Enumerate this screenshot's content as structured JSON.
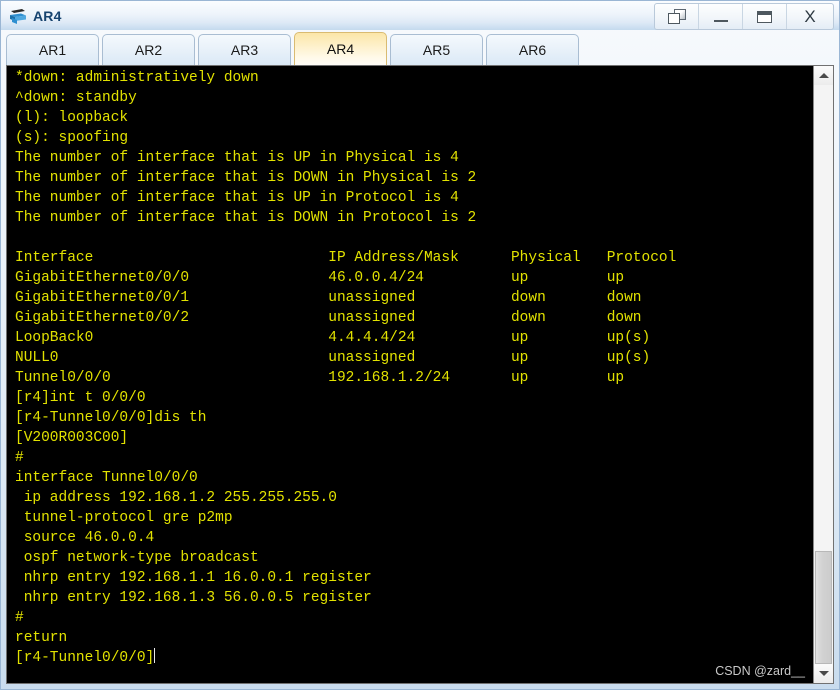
{
  "window": {
    "title": "AR4",
    "icon": "router-icon",
    "controls": [
      {
        "name": "restore-button",
        "icon": "restore-icon",
        "label": ""
      },
      {
        "name": "minimize-button",
        "icon": "minimize-icon",
        "label": ""
      },
      {
        "name": "maximize-button",
        "icon": "maximize-icon",
        "label": ""
      },
      {
        "name": "close-button",
        "icon": "close-icon",
        "label": "X"
      }
    ]
  },
  "tabs": [
    {
      "label": "AR1",
      "active": false
    },
    {
      "label": "AR2",
      "active": false
    },
    {
      "label": "AR3",
      "active": false
    },
    {
      "label": "AR4",
      "active": true
    },
    {
      "label": "AR5",
      "active": false
    },
    {
      "label": "AR6",
      "active": false
    }
  ],
  "terminal": {
    "text_color": "#e2e200",
    "background_color": "#000000",
    "lines": [
      "*down: administratively down",
      "^down: standby",
      "(l): loopback",
      "(s): spoofing",
      "The number of interface that is UP in Physical is 4",
      "The number of interface that is DOWN in Physical is 2",
      "The number of interface that is UP in Protocol is 4",
      "The number of interface that is DOWN in Protocol is 2",
      "",
      "Interface                           IP Address/Mask      Physical   Protocol",
      "GigabitEthernet0/0/0                46.0.0.4/24          up         up",
      "GigabitEthernet0/0/1                unassigned           down       down",
      "GigabitEthernet0/0/2                unassigned           down       down",
      "LoopBack0                           4.4.4.4/24           up         up(s)",
      "NULL0                               unassigned           up         up(s)",
      "Tunnel0/0/0                         192.168.1.2/24       up         up",
      "[r4]int t 0/0/0",
      "[r4-Tunnel0/0/0]dis th",
      "[V200R003C00]",
      "#",
      "interface Tunnel0/0/0",
      " ip address 192.168.1.2 255.255.255.0",
      " tunnel-protocol gre p2mp",
      " source 46.0.0.4",
      " ospf network-type broadcast",
      " nhrp entry 192.168.1.1 16.0.0.1 register",
      " nhrp entry 192.168.1.3 56.0.0.5 register",
      "#",
      "return"
    ],
    "prompt": "[r4-Tunnel0/0/0]",
    "watermark": "CSDN @zard__",
    "interface_table": {
      "headers": [
        "Interface",
        "IP Address/Mask",
        "Physical",
        "Protocol"
      ],
      "rows": [
        [
          "GigabitEthernet0/0/0",
          "46.0.0.4/24",
          "up",
          "up"
        ],
        [
          "GigabitEthernet0/0/1",
          "unassigned",
          "down",
          "down"
        ],
        [
          "GigabitEthernet0/0/2",
          "unassigned",
          "down",
          "down"
        ],
        [
          "LoopBack0",
          "4.4.4.4/24",
          "up",
          "up(s)"
        ],
        [
          "NULL0",
          "unassigned",
          "up",
          "up(s)"
        ],
        [
          "Tunnel0/0/0",
          "192.168.1.2/24",
          "up",
          "up"
        ]
      ]
    },
    "counters": {
      "up_physical": "4",
      "down_physical": "2",
      "up_protocol": "4",
      "down_protocol": "2"
    }
  },
  "scrollbar": {
    "up_arrow": "scroll-up-icon",
    "down_arrow": "scroll-down-icon"
  }
}
